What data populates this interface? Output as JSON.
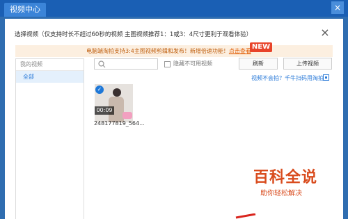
{
  "window": {
    "tab_title": "视频中心",
    "close": "×"
  },
  "dialog": {
    "title": "选择视频（仅支持时长不超过60秒的视频 主图视频推荐1：1或3：4尺寸更利于观看体验）",
    "close": "×"
  },
  "notice": {
    "text": "电脑端淘拍支持3:4主图视频剪辑和发布！新增倍速功能！",
    "link": "点击查看",
    "badge": "NEW"
  },
  "sidebar": {
    "header": "我的视频",
    "items": [
      {
        "label": "全部",
        "selected": true
      }
    ]
  },
  "toolbar": {
    "search_placeholder": "",
    "hide_unavailable_label": "隐藏不可用视频",
    "hide_unavailable_checked": false,
    "refresh_label": "刷新",
    "upload_label": "上传视频",
    "scan_link": "视频不会拍？千牛扫码用淘拍"
  },
  "videos": [
    {
      "name": "248177819_564...",
      "duration": "00:09",
      "selected": true
    }
  ],
  "watermark": {
    "title": "百科全说",
    "subtitle": "助你轻松解决"
  },
  "colors": {
    "accent": "#2a7ad8",
    "titlebar": "#1a5fb4",
    "notice_bg": "#fcefe0",
    "watermark": "#d94c1e"
  }
}
